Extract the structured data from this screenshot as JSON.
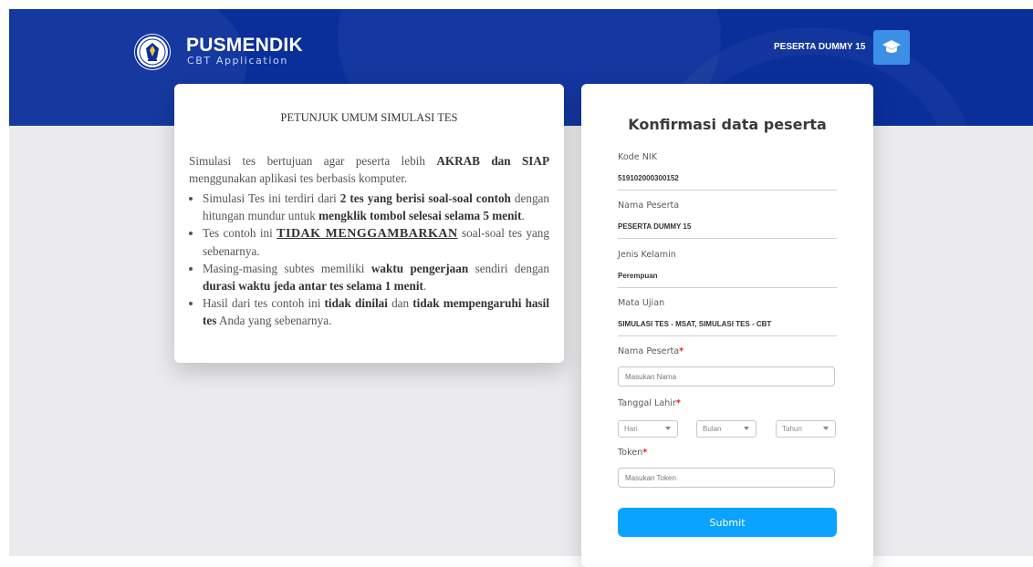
{
  "header": {
    "brand_title": "PUSMENDIK",
    "brand_subtitle": "CBT Application",
    "user_name": "PESERTA DUMMY 15",
    "avatar_icon": "graduation-cap-icon",
    "logo_icon": "tut-wuri-handayani-emblem",
    "background_color": "#0a2f9b"
  },
  "instructions": {
    "title": "PETUNJUK UMUM SIMULASI TES",
    "intro": {
      "p1": "Simulasi tes bertujuan agar peserta lebih ",
      "b1": "AKRAB dan SIAP",
      "p2": " menggunakan aplikasi tes berbasis komputer."
    },
    "item1": {
      "p1": "Simulasi Tes ini terdiri dari ",
      "b1": "2 tes yang berisi soal-soal contoh",
      "p2": " dengan hitungan mundur untuk ",
      "b2": "mengklik tombol selesai selama 5 menit",
      "p3": "."
    },
    "item2": {
      "p1": "Tes contoh ini ",
      "u1": "TIDAK MENGGAMBARKAN",
      "p2": " soal-soal tes yang sebenarnya."
    },
    "item3": {
      "p1": "Masing-masing subtes memiliki ",
      "b1": "waktu pengerjaan",
      "p2": " sendiri dengan ",
      "b2": "durasi waktu jeda antar tes selama 1 menit",
      "p3": "."
    },
    "item4": {
      "p1": "Hasil dari tes contoh ini ",
      "b1": "tidak dinilai",
      "p2": " dan ",
      "b2": "tidak mempengaruhi hasil tes",
      "p3": " Anda yang sebenarnya."
    }
  },
  "form": {
    "title": "Konfirmasi data peserta",
    "nik": {
      "label": "Kode NIK",
      "value": "519102000300152"
    },
    "nama": {
      "label": "Nama Peserta",
      "value": "PESERTA DUMMY 15"
    },
    "jenis_kelamin": {
      "label": "Jenis Kelamin",
      "value": "Perempuan"
    },
    "mata_ujian": {
      "label": "Mata Ujian",
      "value": "SIMULASI TES - MSAT, SIMULASI TES - CBT"
    },
    "nama_input": {
      "label": "Nama Peserta",
      "required_mark": "*",
      "placeholder": "Masukan Nama"
    },
    "tanggal_lahir": {
      "label": "Tanggal Lahir",
      "required_mark": "*",
      "day": "Hari",
      "month": "Bulan",
      "year": "Tahun"
    },
    "token": {
      "label": "Token",
      "required_mark": "*",
      "placeholder": "Masukan Token"
    },
    "submit_label": "Submit",
    "accent_color": "#0aa3ff",
    "required_color": "#d8232a"
  }
}
